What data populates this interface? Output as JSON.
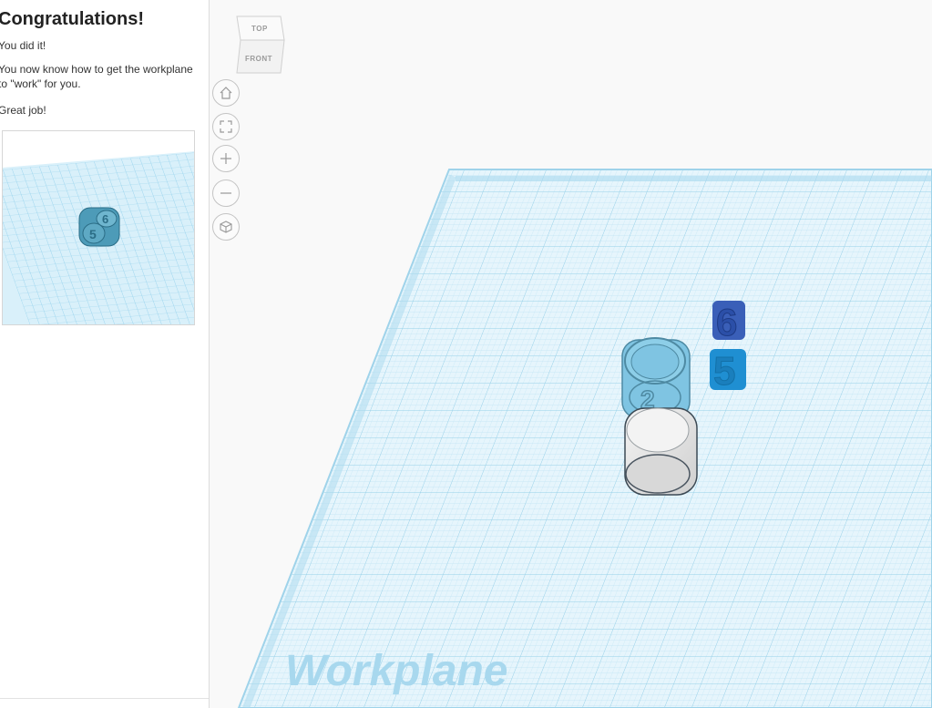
{
  "lesson": {
    "title": "Congratulations!",
    "paragraphs": [
      "You did it!",
      "You now know how to get the workplane to \"work\" for you.",
      "Great job!"
    ],
    "thumbnail_die_numbers": [
      "6",
      "5"
    ]
  },
  "viewcube": {
    "top_label": "TOP",
    "front_label": "FRONT"
  },
  "nav_buttons": [
    {
      "icon": "home-icon"
    },
    {
      "icon": "fit-view-icon"
    },
    {
      "icon": "zoom-in-icon"
    },
    {
      "icon": "zoom-out-icon"
    },
    {
      "icon": "orthographic-view-icon"
    }
  ],
  "workplane": {
    "label": "Workplane",
    "objects": [
      {
        "name": "number-6",
        "text": "6",
        "color": "#2b4fa8"
      },
      {
        "name": "number-5",
        "text": "5",
        "color": "#1f8fd2"
      },
      {
        "name": "die-with-number-2",
        "text": "2",
        "color": "#7fc4e2"
      },
      {
        "name": "white-cube",
        "color": "#e8e8e8"
      }
    ]
  },
  "colors": {
    "grid": "#bfe4f4",
    "grid_major": "#a6d6ec",
    "plane": "#e6f5fc",
    "accent_blue": "#1f8fd2",
    "dark_blue": "#2b4fa8"
  }
}
